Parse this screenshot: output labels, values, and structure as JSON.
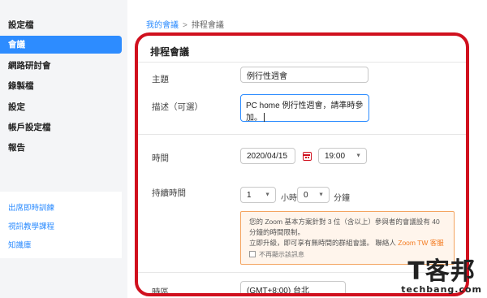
{
  "sidebar": {
    "items": [
      {
        "label": "設定檔"
      },
      {
        "label": "會議"
      },
      {
        "label": "網路研討會"
      },
      {
        "label": "錄製檔"
      },
      {
        "label": "設定"
      },
      {
        "label": "帳戶設定檔"
      },
      {
        "label": "報告"
      }
    ],
    "active_index": 1,
    "links": [
      {
        "label": "出席即時訓練"
      },
      {
        "label": "視訊教學課程"
      },
      {
        "label": "知識庫"
      }
    ]
  },
  "breadcrumb": {
    "parent": "我的會議",
    "separator": ">",
    "current": "排程會議"
  },
  "form": {
    "title": "排程會議",
    "topic": {
      "label": "主題",
      "value": "例行性週會"
    },
    "description": {
      "label": "描述（可選）",
      "value": "PC home 例行性週會，請準時參加。"
    },
    "when": {
      "label": "時間",
      "date": "2020/04/15",
      "time": "19:00"
    },
    "duration": {
      "label": "持續時間",
      "hours": "1",
      "hours_unit": "小時",
      "minutes": "0",
      "minutes_unit": "分鐘"
    },
    "notice": {
      "line1": "您的 Zoom 基本方案針對 3 位（含以上）參與者的會議設有 40",
      "line2": "分鐘的時間限制。",
      "line3_prefix": "立即升級，即可享有無時間的群組會議。 聯絡人",
      "upgrade_link": "Zoom TW 客服",
      "checkbox_label": "不再顯示該訊息"
    },
    "timezone": {
      "label": "時區",
      "value": "(GMT+8:00) 台北"
    }
  },
  "watermark": {
    "big": "T客邦",
    "small": "techbang.com"
  },
  "colors": {
    "accent": "#2d8cff",
    "highlight_border": "#d0101e",
    "notice_border": "#f4a45f",
    "notice_link": "#f47b20"
  }
}
